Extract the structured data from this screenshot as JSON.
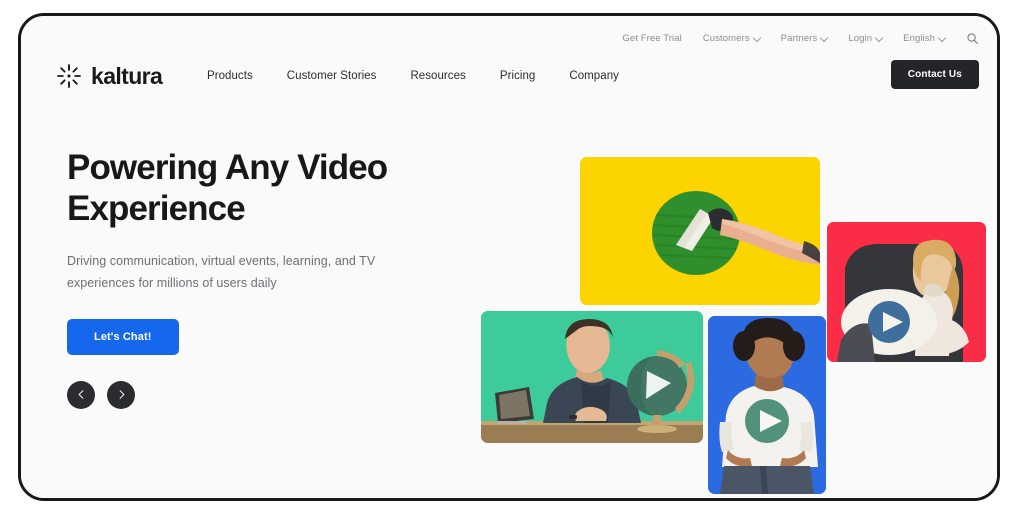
{
  "brand": {
    "name": "kaltura",
    "logo_icon": "starburst-icon",
    "accent_blue": "#1568ec",
    "dark": "#242528"
  },
  "utility_nav": {
    "items": [
      {
        "label": "Get Free Trial",
        "has_chevron": false
      },
      {
        "label": "Customers",
        "has_chevron": true
      },
      {
        "label": "Partners",
        "has_chevron": true
      },
      {
        "label": "Login",
        "has_chevron": true
      },
      {
        "label": "English",
        "has_chevron": true
      }
    ],
    "search_icon": "search-icon"
  },
  "main_nav": {
    "items": [
      {
        "label": "Products"
      },
      {
        "label": "Customer Stories"
      },
      {
        "label": "Resources"
      },
      {
        "label": "Pricing"
      },
      {
        "label": "Company"
      }
    ],
    "cta_label": "Contact Us"
  },
  "hero": {
    "title": "Powering Any Video Experience",
    "subtitle": "Driving communication, virtual events, learning, and TV experiences for millions of users daily",
    "cta_label": "Let's Chat!",
    "carousel": {
      "prev_icon": "chevron-left-icon",
      "next_icon": "chevron-right-icon"
    }
  },
  "collage": {
    "tiles": [
      {
        "name": "yellow",
        "color": "#fcd400",
        "description": "Hand holding a paint scraper over a green scribbled circle"
      },
      {
        "name": "red",
        "color": "#fb2c45",
        "description": "Woman reclining in a chair hugging a white pillow with a blue play button"
      },
      {
        "name": "green",
        "color": "#3ecb9b",
        "description": "Man seated at a desk with a tablet beside a globe marked with a white play triangle"
      },
      {
        "name": "blue",
        "color": "#2b6ae0",
        "description": "Smiling person in a white t-shirt printed with a green play button"
      }
    ]
  }
}
